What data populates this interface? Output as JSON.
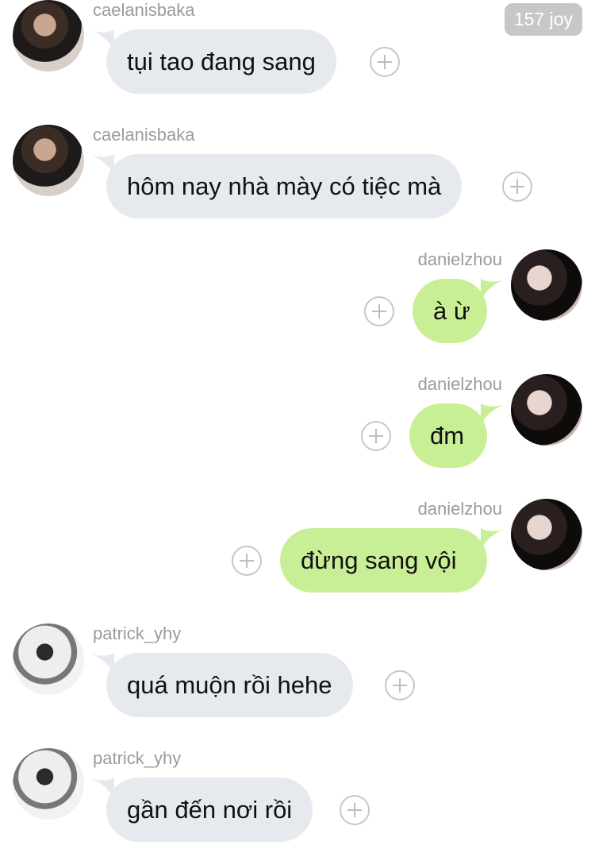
{
  "badge": {
    "label": "157 joy"
  },
  "messages": [
    {
      "side": "left",
      "user": "caelanisbaka",
      "avatar": "avatar-caelanisbaka",
      "text": "tụi tao đang sang"
    },
    {
      "side": "left",
      "user": "caelanisbaka",
      "avatar": "avatar-caelanisbaka",
      "text": "hôm nay nhà mày có tiệc mà"
    },
    {
      "side": "right",
      "user": "danielzhou",
      "avatar": "avatar-danielzhou",
      "text": "à ừ"
    },
    {
      "side": "right",
      "user": "danielzhou",
      "avatar": "avatar-danielzhou",
      "text": "đm"
    },
    {
      "side": "right",
      "user": "danielzhou",
      "avatar": "avatar-danielzhou",
      "text": "đừng sang vội"
    },
    {
      "side": "left",
      "user": "patrick_yhy",
      "avatar": "avatar-patrick_yhy",
      "text": "quá muộn rồi hehe"
    },
    {
      "side": "left",
      "user": "patrick_yhy",
      "avatar": "avatar-patrick_yhy",
      "text": "gần đến nơi rồi"
    }
  ],
  "colors": {
    "left_bubble": "#e6e9ee",
    "right_bubble": "#c9ef96",
    "username": "#9b9b9b",
    "badge": "#c7c7c9"
  }
}
